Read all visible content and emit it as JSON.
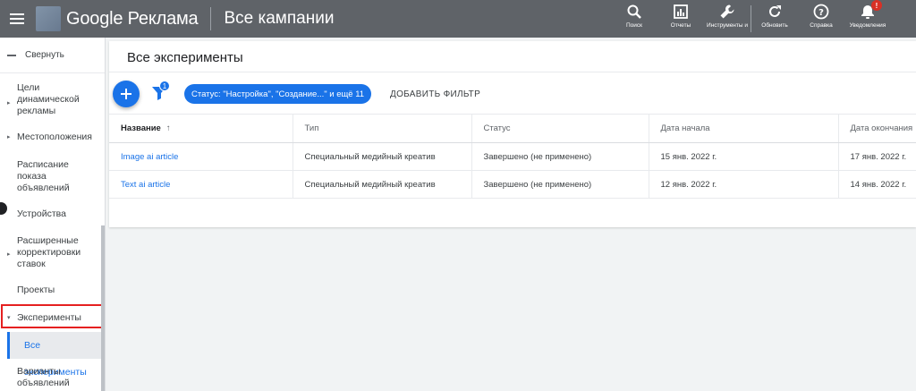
{
  "header": {
    "brand": "Google Реклама",
    "section_title": "Все кампании",
    "actions": [
      {
        "label": "Поиск",
        "icon": "search-icon"
      },
      {
        "label": "Отчеты",
        "icon": "reports-icon"
      },
      {
        "label": "Инструменты и",
        "icon": "wrench-icon"
      },
      {
        "label": "Обновить",
        "icon": "refresh-icon"
      },
      {
        "label": "Справка",
        "icon": "help-icon"
      },
      {
        "label": "Уведомления",
        "icon": "bell-icon",
        "badge": "!"
      }
    ]
  },
  "sidebar": {
    "collapse_label": "Свернуть",
    "items": [
      {
        "label": "Цели динамической рекламы",
        "arrow": "▸"
      },
      {
        "label": "Местоположения",
        "arrow": "▸"
      },
      {
        "label": "Расписание показа объявлений",
        "arrow": ""
      },
      {
        "label": "Устройства",
        "arrow": ""
      },
      {
        "label": "Расширенные корректировки ставок",
        "arrow": "▸"
      },
      {
        "label": "Проекты",
        "arrow": ""
      },
      {
        "label": "Эксперименты",
        "arrow": "▾"
      },
      {
        "label": "Все эксперименты",
        "arrow": ""
      },
      {
        "label": "Варианты объявлений",
        "arrow": ""
      }
    ]
  },
  "main": {
    "title": "Все эксперименты",
    "add_icon": "plus-icon",
    "filter_count": "1",
    "filter_chip": "Статус: \"Настройка\", \"Создание...\" и ещё 11",
    "add_filter_label": "ДОБАВИТЬ ФИЛЬТР",
    "table": {
      "columns": [
        "Название",
        "Тип",
        "Статус",
        "Дата начала",
        "Дата окончания"
      ],
      "sort_arrow": "↑",
      "rows": [
        [
          "Image ai article",
          "Специальный медийный креатив",
          "Завершено (не применено)",
          "15 янв. 2022 г.",
          "17 янв. 2022 г."
        ],
        [
          "Text ai article",
          "Специальный медийный креатив",
          "Завершено (не применено)",
          "12 янв. 2022 г.",
          "14 янв. 2022 г."
        ]
      ]
    }
  },
  "colors": {
    "topbar": "#5f6368",
    "accent": "#1a73e8",
    "highlight": "#e52020"
  }
}
